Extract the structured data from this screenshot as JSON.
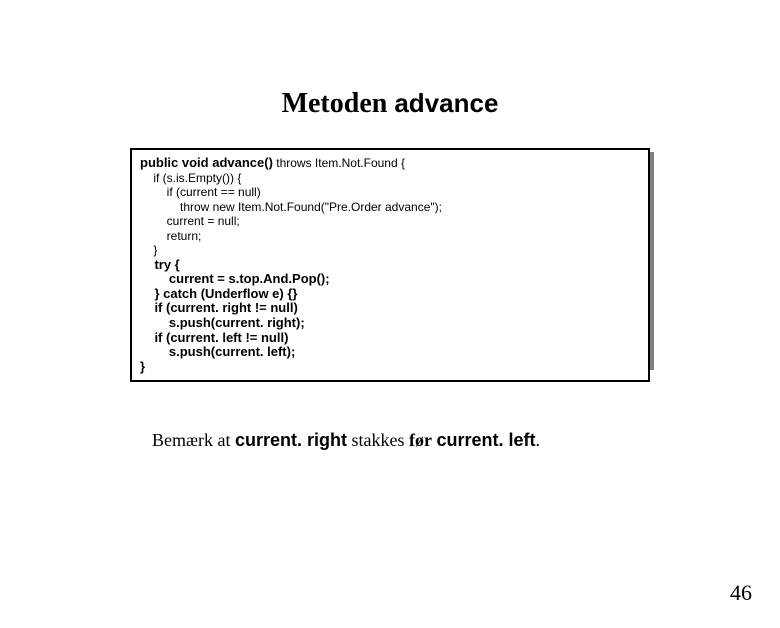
{
  "title": {
    "part1": "Metoden ",
    "part2": "advance"
  },
  "code": {
    "l1a": "public void advance()",
    "l1b": " throws Item.Not.Found {",
    "l2": "    if (s.is.Empty()) {",
    "l3": "        if (current == null)",
    "l4": "            throw new Item.Not.Found(\"Pre.Order advance\");",
    "l5": "        current = null;",
    "l6": "        return;",
    "l7": "    }",
    "l8": "    try {",
    "l9": "        current = s.top.And.Pop();",
    "l10": "    } catch (Underflow e) {}",
    "l11": "    if (current. right != null)",
    "l12": "        s.push(current. right);",
    "l13": "    if (current. left != null)",
    "l14": "        s.push(current. left);",
    "l15": "}"
  },
  "note": {
    "p1": "Bemærk at ",
    "p2": "current. right",
    "p3": " stakkes ",
    "p4": "før",
    "p5": " ",
    "p6": "current. left",
    "p7": "."
  },
  "pagenum": "46"
}
